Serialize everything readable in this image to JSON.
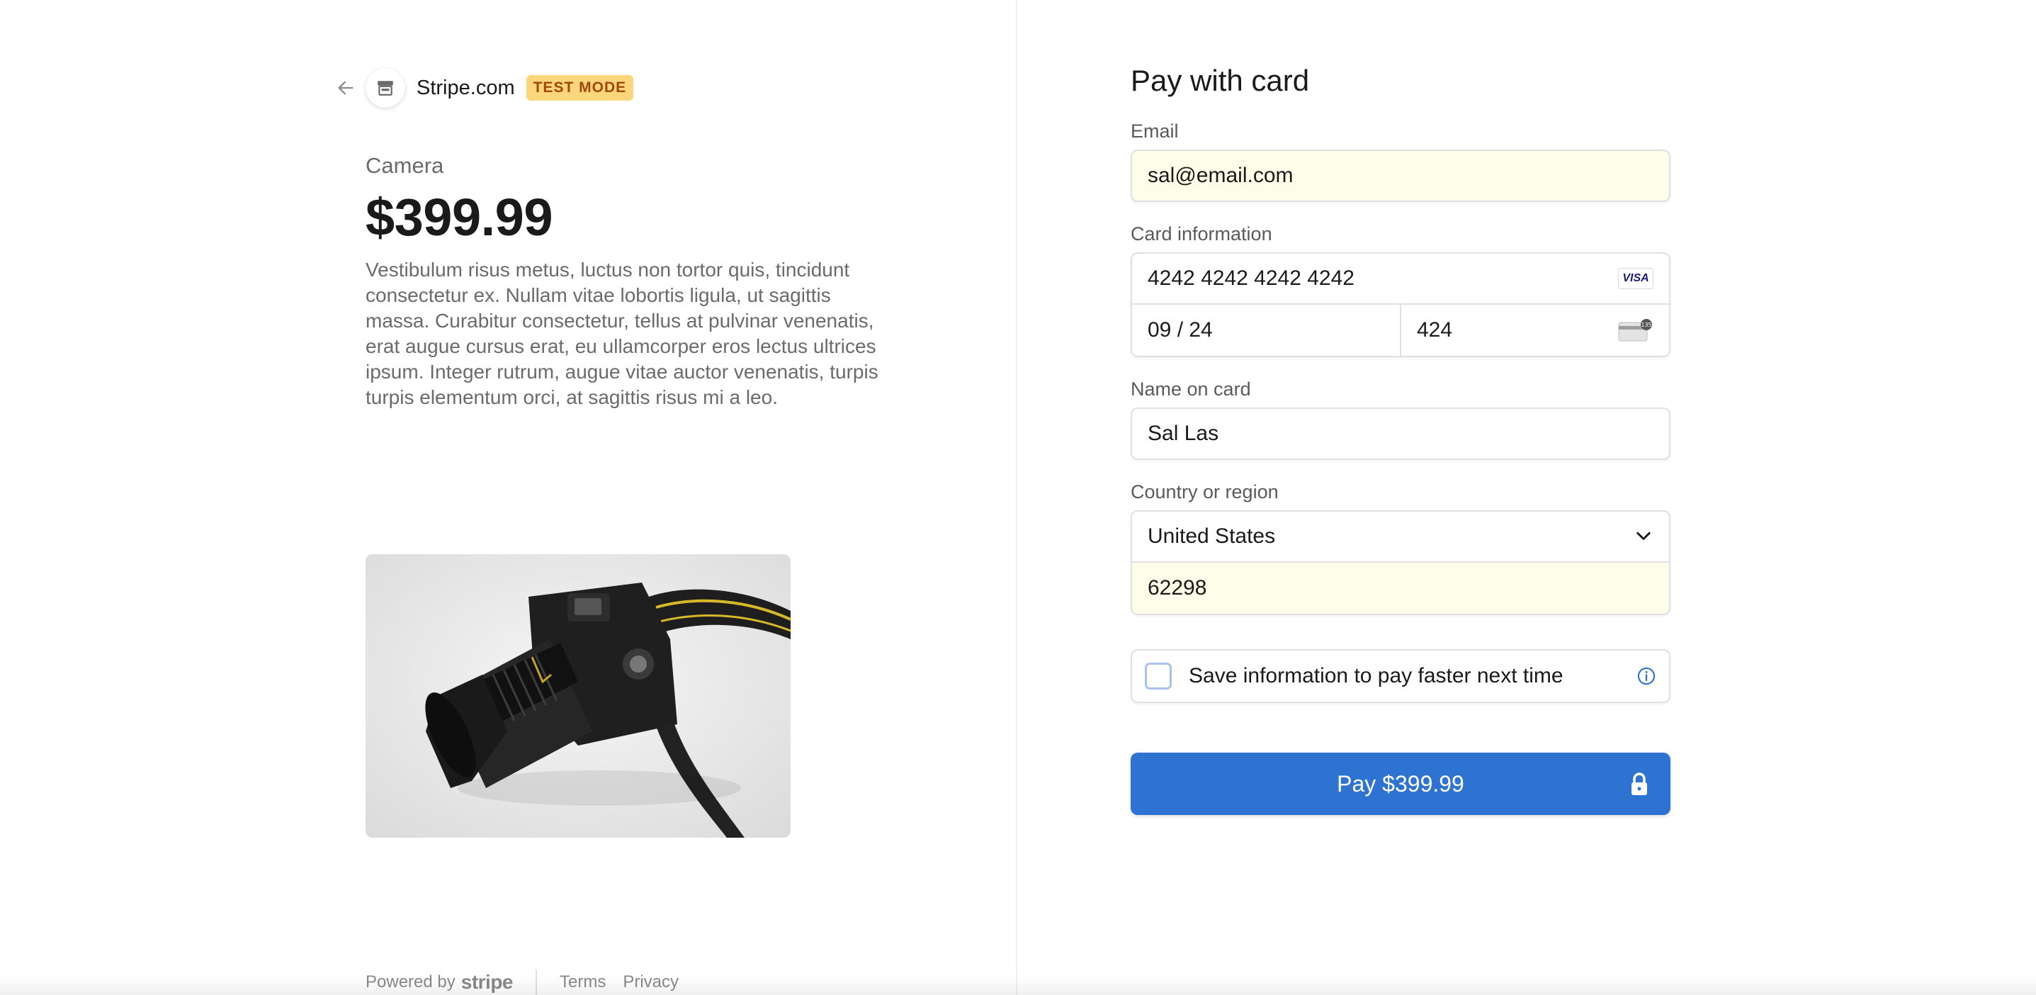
{
  "header": {
    "merchant_name": "Stripe.com",
    "test_badge": "TEST MODE"
  },
  "product": {
    "name": "Camera",
    "price": "$399.99",
    "description": "Vestibulum risus metus, luctus non tortor quis, tincidunt consectetur ex. Nullam vitae lobortis ligula, ut sagittis massa. Curabitur consectetur, tellus at pulvinar venenatis, erat augue cursus erat, eu ullamcorper eros lectus ultrices ipsum. Integer rutrum, augue vitae auctor venenatis, turpis turpis elementum orci, at sagittis risus mi a leo."
  },
  "footer": {
    "powered_by": "Powered by",
    "stripe_wordmark": "stripe",
    "terms": "Terms",
    "privacy": "Privacy"
  },
  "form": {
    "title": "Pay with card",
    "email_label": "Email",
    "email_value": "sal@email.com",
    "card_label": "Card information",
    "card_number": "4242 4242 4242 4242",
    "card_brand": "VISA",
    "expiry": "09 / 24",
    "cvc": "424",
    "name_label": "Name on card",
    "name_value": "Sal Las",
    "country_label": "Country or region",
    "country_value": "United States",
    "zip_value": "62298",
    "save_label": "Save information to pay faster next time",
    "pay_label": "Pay $399.99"
  },
  "colors": {
    "accent": "#2e72d2",
    "test_badge_bg": "#fcd67a",
    "test_badge_text": "#a2470b",
    "autofill_bg": "#fefde9"
  },
  "icons": [
    "back-arrow-icon",
    "store-icon",
    "visa-icon",
    "cvc-card-icon",
    "chevron-down-icon",
    "info-icon",
    "lock-icon"
  ]
}
